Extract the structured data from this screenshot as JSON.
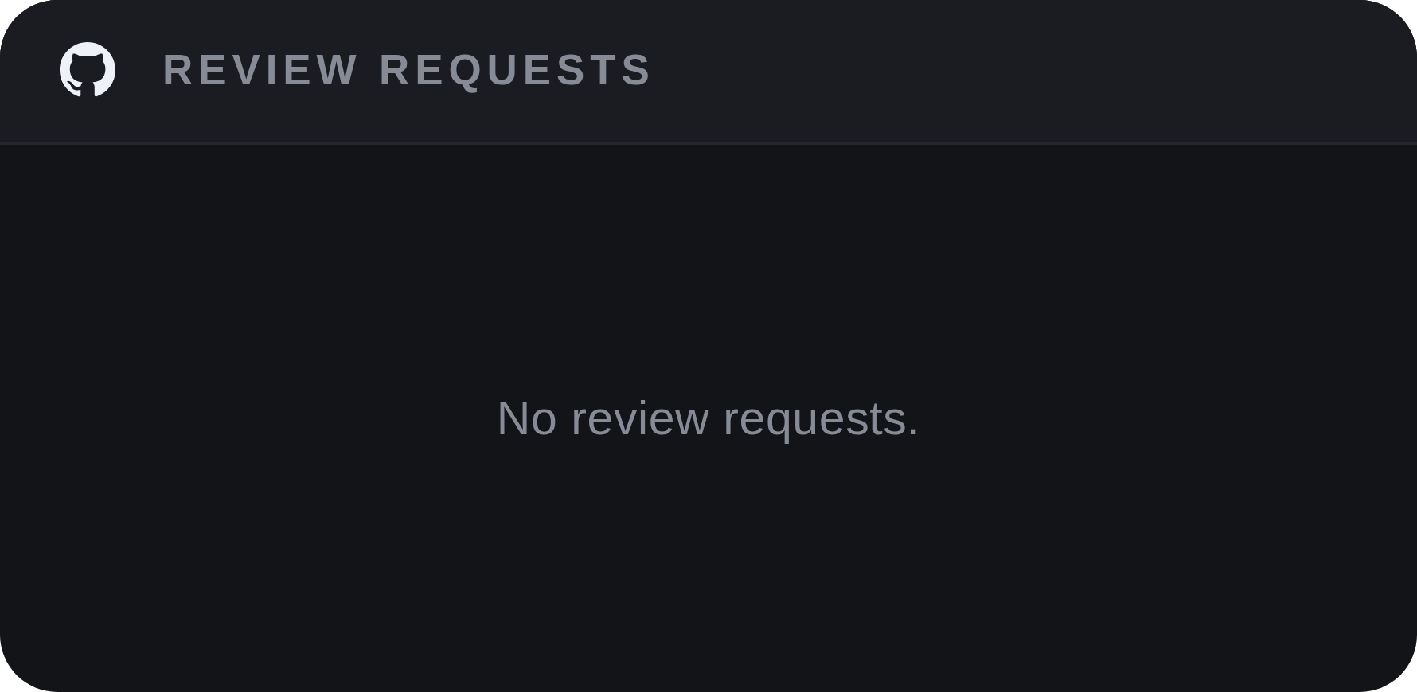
{
  "header": {
    "title": "REVIEW REQUESTS"
  },
  "empty_state": {
    "message": "No review requests."
  }
}
